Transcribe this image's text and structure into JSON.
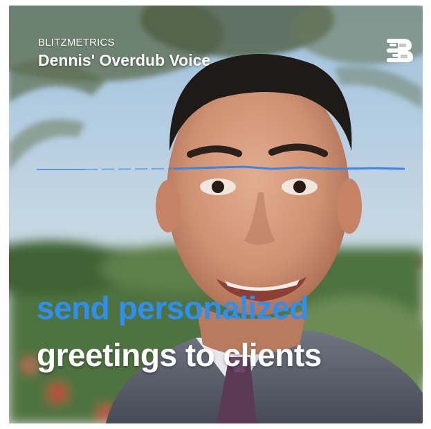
{
  "overlay": {
    "brand": "BLITZMETRICS",
    "title": "Dennis' Overdub Voice"
  },
  "logo": {
    "icon": "blitzmetrics-logo-icon",
    "color": "#ffffff"
  },
  "captions": {
    "line1": "send personalized",
    "line2": "greetings to clients",
    "line1_color": "#2f8ff0",
    "line2_color": "#ffffff"
  },
  "waveform": {
    "color": "#3a86e0"
  }
}
